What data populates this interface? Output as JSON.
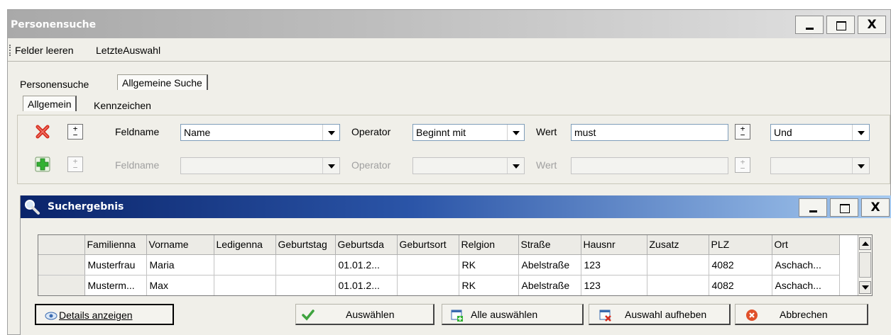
{
  "window": {
    "title": "Personensuche",
    "min_label": "_",
    "close_label": "X"
  },
  "menu": {
    "items": [
      "Felder leeren",
      "LetzteAuswahl"
    ]
  },
  "tabs_outer": [
    "Personensuche",
    "Allgemeine Suche"
  ],
  "tabs_inner": [
    "Allgemein",
    "Kennzeichen"
  ],
  "filter": {
    "rows": [
      {
        "remove_icon": "red-x-icon",
        "pm_label": "+\n−",
        "field_label": "Feldname",
        "field_value": "Name",
        "operator_label": "Operator",
        "operator_value": "Beginnt mit",
        "value_label": "Wert",
        "value_text": "must",
        "logic_value": "Und",
        "enabled": true
      },
      {
        "add_icon": "green-plus-icon",
        "pm_label": "+\n−",
        "field_label": "Feldname",
        "field_value": "",
        "operator_label": "Operator",
        "operator_value": "",
        "value_label": "Wert",
        "value_text": "",
        "logic_value": "",
        "enabled": false
      }
    ]
  },
  "results": {
    "title": "Suchergebnis",
    "min_label": "_",
    "close_label": "X",
    "columns": [
      "Familienna",
      "Vorname",
      "Ledigenna",
      "Geburtstag",
      "Geburtsda",
      "Geburtsort",
      "Relgion",
      "Straße",
      "Hausnr",
      "Zusatz",
      "PLZ",
      "Ort"
    ],
    "rows": [
      [
        "Musterfrau",
        "Maria",
        "",
        "",
        "01.01.2...",
        "",
        "RK",
        "Abelstraße",
        "123",
        "",
        "4082",
        "Aschach..."
      ],
      [
        "Musterm...",
        "Max",
        "",
        "",
        "01.01.2...",
        "",
        "RK",
        "Abelstraße",
        "123",
        "",
        "4082",
        "Aschach..."
      ]
    ]
  },
  "buttons": {
    "details": "Details anzeigen",
    "select": "Auswählen",
    "select_all": "Alle auswählen",
    "deselect": "Auswahl aufheben",
    "cancel": "Abbrechen"
  },
  "colors": {
    "title_gradient_start": "#0a246a",
    "title_gradient_end": "#a6caf0",
    "remove_red": "#d62d1e",
    "add_green": "#33b133"
  }
}
